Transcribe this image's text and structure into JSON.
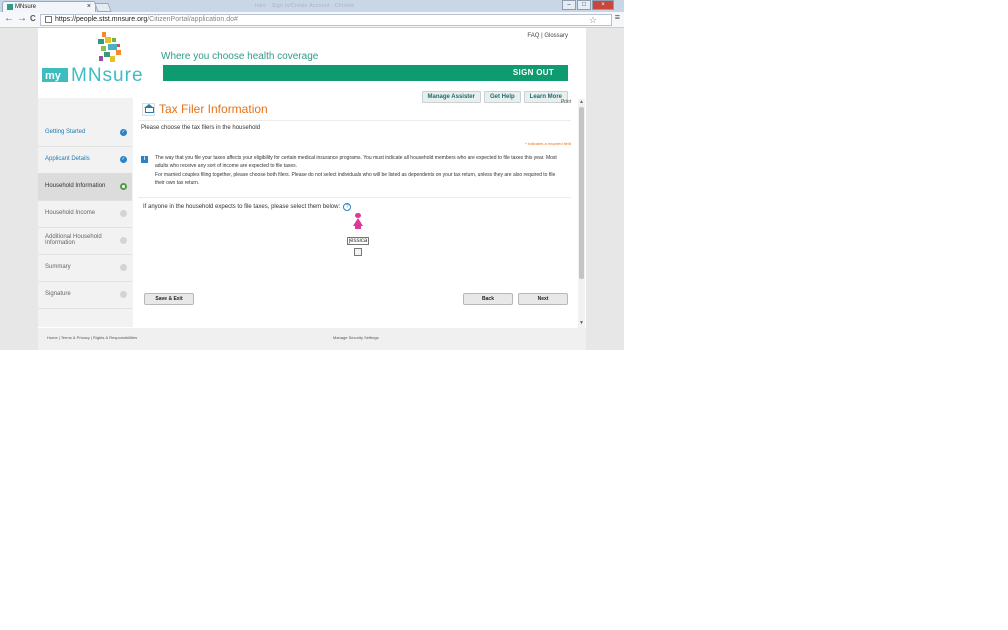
{
  "browser": {
    "tab_title": "MNsure",
    "tab_close": "×",
    "background_title": "Intro · Sign In/Create Account · Chrome",
    "url_host": "https://people.stst.mnsure.org",
    "url_path": "/CitizenPortal/application.do#",
    "window_controls": [
      "–",
      "□",
      "×"
    ],
    "nav_back": "←",
    "nav_forward": "→",
    "nav_reload": "C",
    "star": "☆",
    "menu": "≡"
  },
  "header": {
    "faq": "FAQ",
    "separator": "|",
    "glossary": "Glossary",
    "logo_my": "my",
    "logo_mnsure": "MNsure",
    "tagline": "Where you choose health coverage",
    "sign_out": "SIGN OUT",
    "links": [
      "Manage Assister",
      "Get Help",
      "Learn More"
    ]
  },
  "sidebar": {
    "items": [
      {
        "label": "Getting Started",
        "status": "done"
      },
      {
        "label": "Applicant Details",
        "status": "done"
      },
      {
        "label": "Household Information",
        "status": "active"
      },
      {
        "label": "Household Income",
        "status": "pending"
      },
      {
        "label": "Additional Household Information",
        "status": "pending"
      },
      {
        "label": "Summary",
        "status": "pending"
      },
      {
        "label": "Signature",
        "status": "pending"
      }
    ]
  },
  "main": {
    "title": "Tax Filer Information",
    "print": "Print",
    "prompt": "Please choose the tax filers in the household",
    "required_note": "* indicates a required field",
    "info_icon": "i",
    "info_p1": "The way that you file your taxes affects your eligibility for certain medical insurance programs. You must indicate all household members who are expected to file taxes this year. Most adults who receive any sort of income are expected to file taxes.",
    "info_p2": "For married couples filing together, please choose both filers. Please do not select individuals who will be listed as dependents on your tax return, unless they are also required to file their own tax return.",
    "question": "If anyone in the household expects to file taxes, please select them below:",
    "help": "?",
    "person_name": "jessica",
    "buttons": {
      "save_exit": "Save & Exit",
      "back": "Back",
      "next": "Next"
    }
  },
  "footer": {
    "home": "Home",
    "terms": "Terms & Privacy",
    "rights": "Rights & Responsibilities",
    "sep": " | ",
    "security": "Manage Security Settings"
  },
  "colors": {
    "brand_teal": "#2f9b86",
    "accent_orange": "#e5731b",
    "link_blue": "#1f7bb3",
    "signout_green": "#0f9b70"
  }
}
